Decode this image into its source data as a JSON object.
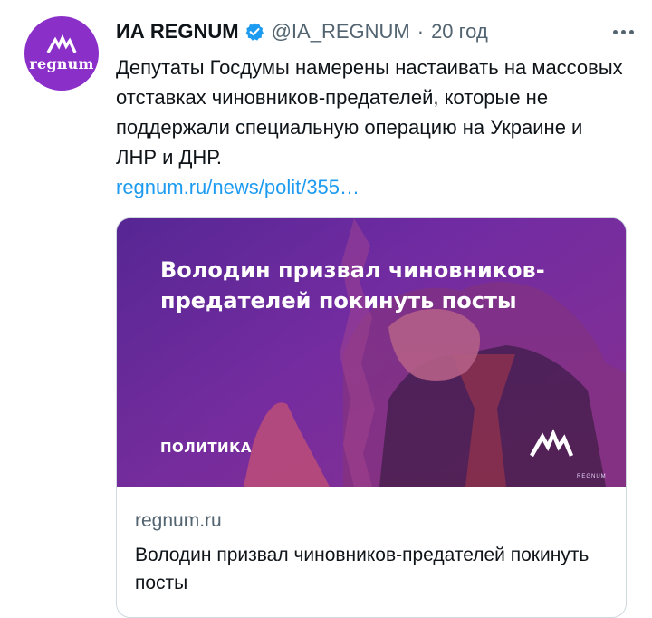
{
  "tweet": {
    "author_name": "ИА REGNUM",
    "handle": "@IA_REGNUM",
    "separator": "·",
    "time": "20 год",
    "avatar_text": "regnum",
    "text": "Депутаты Госдумы намерены настаивать на массовых отставках чиновников-предателей, которые не поддержали специальную операцию на Украине и ЛНР и ДНР.",
    "link": "regnum.ru/news/polit/355…"
  },
  "card": {
    "image_headline": "Володин призвал чиновников-предателей покинуть посты",
    "image_category": "ПОЛИТИКА",
    "image_watermark": "REGNUM",
    "domain": "regnum.ru",
    "title": "Володин призвал чиновников-предателей покинуть посты"
  },
  "icons": {
    "verified": "verified-badge-icon",
    "more": "more-options-icon",
    "logo": "regnum-logo-icon"
  },
  "colors": {
    "brand": "#8b2fc9",
    "link": "#1d9bf0",
    "verified": "#1d9bf0",
    "secondary_text": "#536471"
  }
}
